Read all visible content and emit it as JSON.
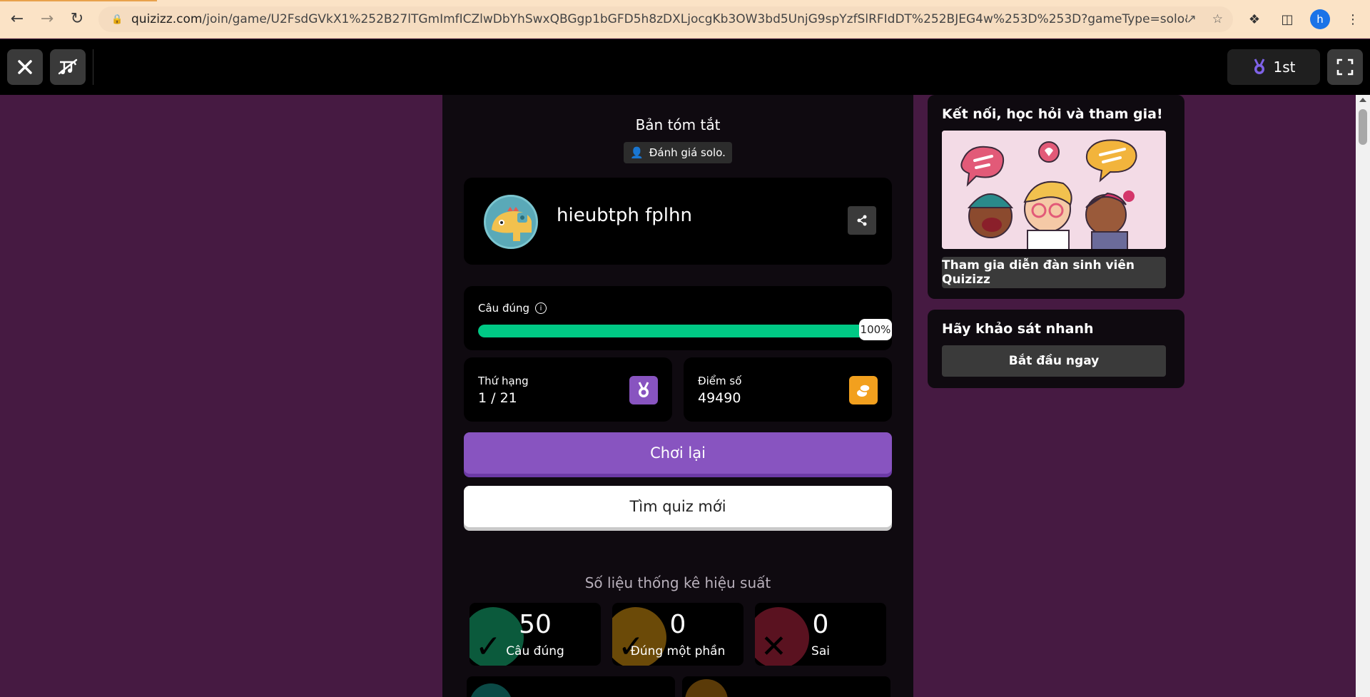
{
  "browser": {
    "url_host": "quizizz.com",
    "url_rest": "/join/game/U2FsdGVkX1%252B27lTGmImfICZlwDbYhSwxQBGgp1bGFD5h8zDXLjocgKb3OW3bd5UnjG9spYzfSlRFIdDT%252BJEG4w%253D%253D?gameType=solo&page=summary",
    "profile_initial": "h"
  },
  "gamebar": {
    "rank": "1st"
  },
  "summary": {
    "title": "Bản tóm tắt",
    "mode_chip": "Đánh giá solo."
  },
  "user": {
    "name": "hieubtph fplhn"
  },
  "accuracy": {
    "label": "Câu đúng",
    "percent_text": "100%",
    "fraction": 1.0
  },
  "stats": {
    "rank_label": "Thứ hạng",
    "rank_value": "1 / 21",
    "score_label": "Điểm số",
    "score_value": "49490"
  },
  "actions": {
    "replay": "Chơi lại",
    "new_quiz": "Tìm quiz mới"
  },
  "performance": {
    "title": "Số liệu thống kê hiệu suất",
    "items": [
      {
        "value": "50",
        "label": "Câu đúng",
        "color": "#0b5a3c"
      },
      {
        "value": "0",
        "label": "Đúng một phần",
        "color": "#6b4a08"
      },
      {
        "value": "0",
        "label": "Sai",
        "color": "#5a1220"
      }
    ]
  },
  "sidebar": {
    "connect_title": "Kết nối, học hỏi và tham gia!",
    "forum_button": "Tham gia diễn đàn sinh viên Quizizz",
    "survey_title": "Hãy khảo sát nhanh",
    "survey_button": "Bắt đầu ngay"
  },
  "colors": {
    "background": "#461a42",
    "accent_purple": "#8854c0",
    "correct_green": "#00c985",
    "score_gold": "#f2a01e"
  }
}
